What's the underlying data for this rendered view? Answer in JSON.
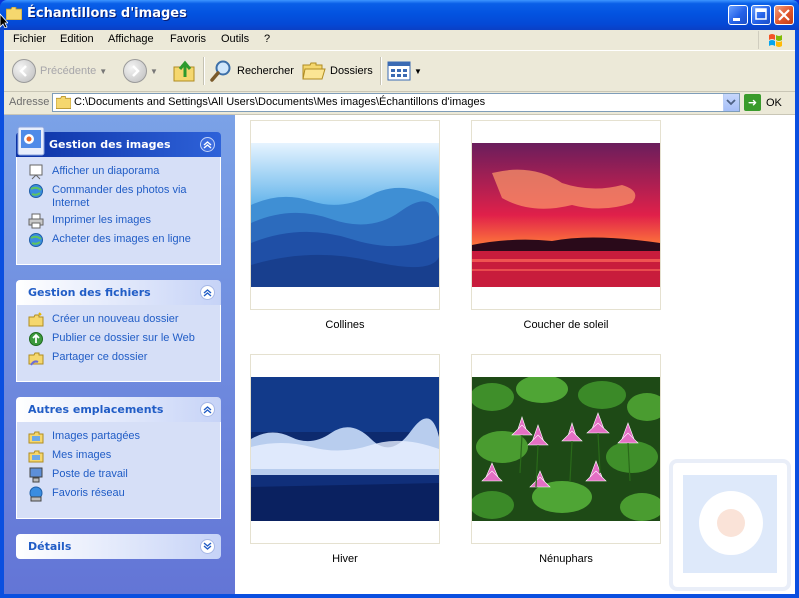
{
  "window": {
    "title": "Échantillons d'images"
  },
  "menu": [
    "Fichier",
    "Edition",
    "Affichage",
    "Favoris",
    "Outils",
    "?"
  ],
  "toolbar": {
    "back_label": "Précédente",
    "search_label": "Rechercher",
    "folders_label": "Dossiers"
  },
  "address": {
    "label": "Adresse",
    "path": "C:\\Documents and Settings\\All Users\\Documents\\Mes images\\Échantillons d'images",
    "go_label": "OK"
  },
  "panels": {
    "images": {
      "title": "Gestion des images",
      "tasks": [
        "Afficher un diaporama",
        "Commander des photos via Internet",
        "Imprimer les images",
        "Acheter des images en ligne"
      ]
    },
    "files": {
      "title": "Gestion des fichiers",
      "tasks": [
        "Créer un nouveau dossier",
        "Publier ce dossier sur le Web",
        "Partager ce dossier"
      ]
    },
    "places": {
      "title": "Autres emplacements",
      "tasks": [
        "Images partagées",
        "Mes images",
        "Poste de travail",
        "Favoris réseau"
      ]
    },
    "details": {
      "title": "Détails"
    }
  },
  "files": [
    {
      "name": "Collines"
    },
    {
      "name": "Coucher de soleil"
    },
    {
      "name": "Hiver"
    },
    {
      "name": "Nénuphars"
    }
  ],
  "colors": {
    "titlebar": "#0353e0",
    "taskpane": "#6f8fdc",
    "link": "#215dc6"
  }
}
